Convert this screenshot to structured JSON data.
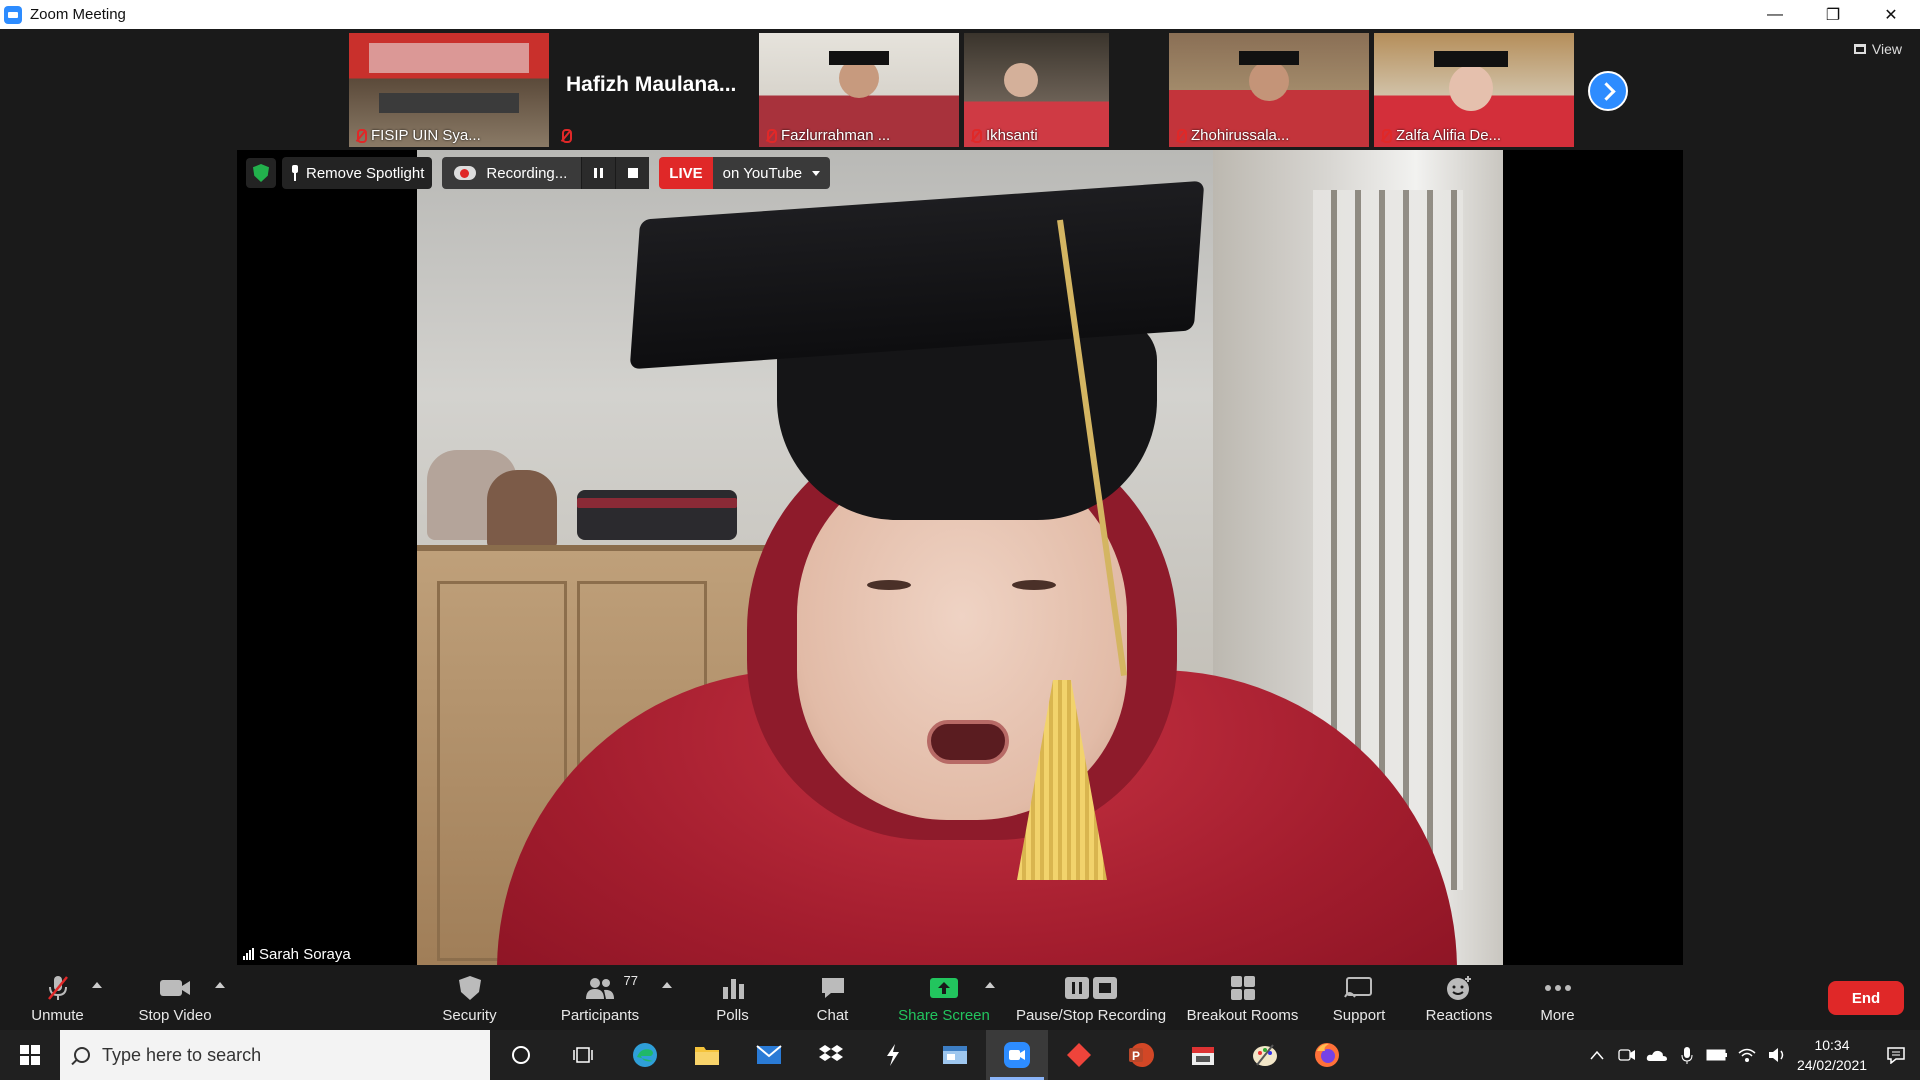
{
  "window": {
    "title": "Zoom Meeting",
    "controls": [
      "—",
      "❐",
      "✕"
    ]
  },
  "view_button": {
    "label": "View"
  },
  "filmstrip": [
    {
      "name": "FISIP UIN Sya...",
      "muted": true,
      "type": "video"
    },
    {
      "name": "Hafizh  Maulana...",
      "muted": true,
      "type": "name-only"
    },
    {
      "name": "Fazlurrahman ...",
      "muted": true,
      "type": "video"
    },
    {
      "name": "Ikhsanti",
      "muted": true,
      "type": "video"
    },
    {
      "name": "Zhohirussala...",
      "muted": true,
      "type": "video"
    },
    {
      "name": "Zalfa Alifia De...",
      "muted": true,
      "type": "video"
    }
  ],
  "main_video": {
    "speaker": "Sarah Soraya"
  },
  "overlay": {
    "spotlight_label": "Remove Spotlight",
    "recording_label": "Recording...",
    "live_tag": "LIVE",
    "live_target": "on YouTube"
  },
  "toolbar": {
    "unmute": "Unmute",
    "stop_video": "Stop Video",
    "security": "Security",
    "participants": "Participants",
    "participants_count": "77",
    "polls": "Polls",
    "chat": "Chat",
    "share_screen": "Share Screen",
    "pause_stop_recording": "Pause/Stop Recording",
    "breakout_rooms": "Breakout Rooms",
    "support": "Support",
    "reactions": "Reactions",
    "more": "More",
    "end": "End",
    "accent_green": "#22c55e",
    "end_color": "#e02828"
  },
  "taskbar": {
    "search_placeholder": "Type here to search",
    "time": "10:34",
    "date": "24/02/2021",
    "apps": [
      "cortana-icon",
      "task-view-icon",
      "edge-icon",
      "file-explorer-icon",
      "mail-icon",
      "dropbox-icon",
      "app-bolt-icon",
      "app-window-icon",
      "zoom-icon",
      "anydesk-icon",
      "powerpoint-icon",
      "media-icon",
      "paint-icon",
      "firefox-icon"
    ]
  }
}
